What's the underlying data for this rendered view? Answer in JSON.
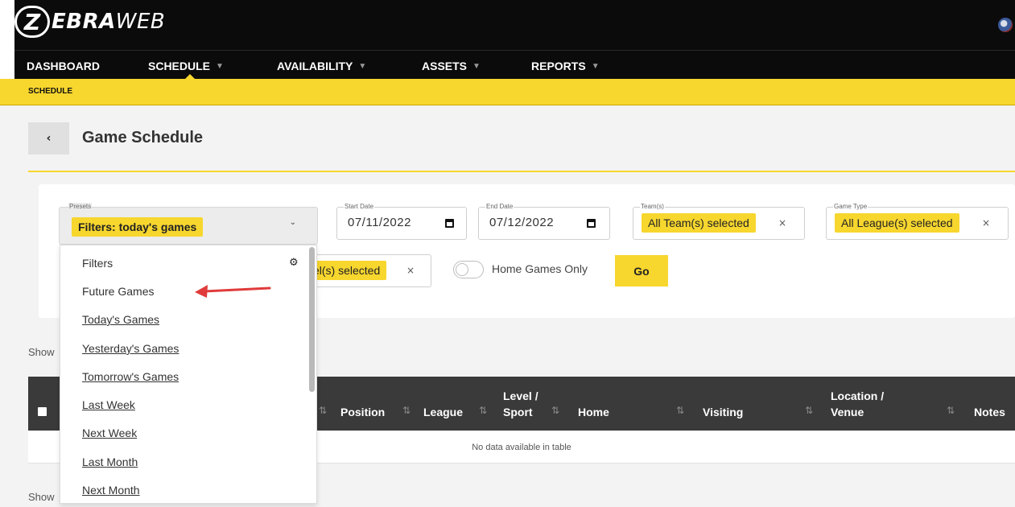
{
  "app": {
    "logo_z": "Z",
    "logo_bold": "EBRA",
    "logo_light": "WEB"
  },
  "nav": {
    "items": [
      {
        "label": "DASHBOARD",
        "has_caret": false
      },
      {
        "label": "SCHEDULE",
        "has_caret": true,
        "active": true
      },
      {
        "label": "AVAILABILITY",
        "has_caret": true
      },
      {
        "label": "ASSETS",
        "has_caret": true
      },
      {
        "label": "REPORTS",
        "has_caret": true
      }
    ],
    "caret": "▼"
  },
  "breadcrumb": "SCHEDULE",
  "page": {
    "back_label": "‹",
    "title": "Game Schedule"
  },
  "filters": {
    "presets": {
      "legend": "Presets",
      "selected": "Filters: today's games",
      "chevron": "⌄"
    },
    "start_date": {
      "legend": "Start Date",
      "value": "07/11/2022"
    },
    "end_date": {
      "legend": "End Date",
      "value": "07/12/2022"
    },
    "teams": {
      "legend": "Team(s)",
      "chip": "All Team(s) selected",
      "clear": "×"
    },
    "game_type": {
      "legend": "Game Type",
      "chip": "All League(s) selected",
      "clear": "×"
    },
    "level": {
      "chip": "el(s) selected",
      "clear": "×"
    },
    "home_games_only": {
      "label": "Home Games Only",
      "checked": false
    },
    "go_label": "Go"
  },
  "dropdown": {
    "header": "Filters",
    "items": [
      "Future Games",
      "Today's Games",
      "Yesterday's Games",
      "Tomorrow's Games",
      "Last Week",
      "Next Week",
      "Last Month",
      "Next Month"
    ]
  },
  "table": {
    "show_text_top": "Show",
    "show_text_bottom": "Show",
    "columns": [
      "Position",
      "League",
      "Level /",
      "Sport",
      "Home",
      "Visiting",
      "Location /",
      "Venue",
      "Notes"
    ],
    "sort_glyph": "⇅",
    "empty_message": "No data available in table"
  },
  "colors": {
    "brand_yellow": "#f7d62e",
    "topbar": "#0b0b0b",
    "table_header": "#3a3a3a",
    "annotation_arrow": "#e03b3b"
  }
}
